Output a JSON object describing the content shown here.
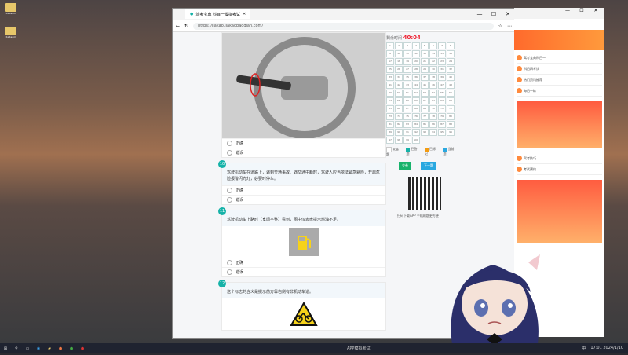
{
  "desktop": {
    "icons": [
      {
        "label": "ᵇᵃᵗᵃᵈᵐ"
      },
      {
        "label": "ᵇᵃᵗᵃᵈᵐ"
      }
    ]
  },
  "browser": {
    "tab_title": "驾考宝典 科目一模拟考试",
    "url": "https://jiakao.jiakaobaodian.com/",
    "window_min": "—",
    "window_max": "☐",
    "window_close": "✕"
  },
  "exam": {
    "timer_label": "剩余时间",
    "timer_value": "40:04",
    "q9": {
      "options": [
        "正确",
        "错误"
      ]
    },
    "q10": {
      "num": "10",
      "text": "驾驶机动车在道路上，遇到交通事故、遇交通中断时，驾驶人应当依法紧急避险，开启危险报警闪光灯，必要时停车。",
      "options": [
        "正确",
        "错误"
      ]
    },
    "q11": {
      "num": "11",
      "text": "驾驶机动车上路时（宽阔平整）看到，图中仪表盘提示燃油不足。",
      "options": [
        "正确",
        "错误"
      ]
    },
    "q12": {
      "num": "12",
      "text": "这个标志的含义是提示前方靠右侧有非机动车道。"
    },
    "grid_numbers": [
      "1",
      "2",
      "3",
      "4",
      "5",
      "6",
      "7",
      "8",
      "9",
      "10",
      "11",
      "12",
      "13",
      "14",
      "15",
      "16",
      "17",
      "18",
      "19",
      "20",
      "21",
      "22",
      "23",
      "24",
      "25",
      "26",
      "27",
      "28",
      "29",
      "30",
      "31",
      "32",
      "33",
      "34",
      "35",
      "36",
      "37",
      "38",
      "39",
      "40",
      "41",
      "42",
      "43",
      "44",
      "45",
      "46",
      "47",
      "48",
      "49",
      "50",
      "51",
      "52",
      "53",
      "54",
      "55",
      "56",
      "57",
      "58",
      "59",
      "60",
      "61",
      "62",
      "63",
      "64",
      "65",
      "66",
      "67",
      "68",
      "69",
      "70",
      "71",
      "72",
      "73",
      "74",
      "75",
      "76",
      "77",
      "78",
      "79",
      "80",
      "81",
      "82",
      "83",
      "84",
      "85",
      "86",
      "87",
      "88",
      "89",
      "90",
      "91",
      "92",
      "93",
      "94",
      "95",
      "96",
      "97",
      "98",
      "99",
      "100"
    ],
    "legend": [
      "未答题",
      "已答题",
      "已标记",
      "当前题"
    ],
    "submit_label": "交卷",
    "next_label": "下一题",
    "qr_caption": "扫码下载APP 手机刷题更方便"
  },
  "sidebar": {
    "items": [
      "驾考宝典科目一",
      "科目四考试",
      "热门资讯推荐",
      "每日一练",
      "驾考技巧",
      "考试预约"
    ],
    "promo": "考试通过率"
  },
  "taskbar": {
    "task_label": "APP模拟考试",
    "time": "17:01",
    "date": "2024/1/10",
    "lang": "中"
  },
  "colors": {
    "accent": "#15b2a8",
    "timer": "#e23333",
    "submit": "#18b36c",
    "next": "#2aa8e0"
  }
}
